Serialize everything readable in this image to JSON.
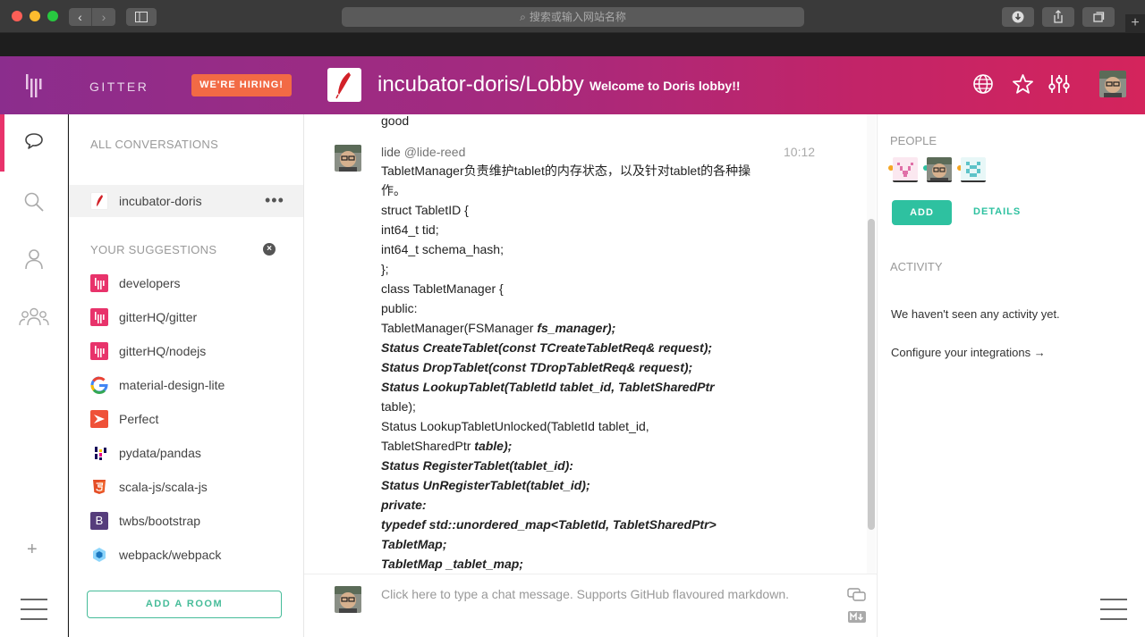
{
  "browser": {
    "url_placeholder": "搜索或输入网站名称",
    "new_tab": "+"
  },
  "header": {
    "brand": "GITTER",
    "hiring": "WE'RE HIRING!",
    "room_title": "incubator-doris/Lobby",
    "room_topic": "Welcome to Doris lobby!!",
    "icons": [
      "globe-icon",
      "star-icon",
      "settings-sliders-icon"
    ]
  },
  "rail": {
    "add": "+"
  },
  "conversations": {
    "all_label": "ALL CONVERSATIONS",
    "active": {
      "label": "incubator-doris",
      "more": "•••"
    },
    "suggestions_label": "YOUR SUGGESTIONS",
    "dismiss": "×",
    "suggestions": [
      {
        "label": "developers",
        "icon": "gitter-icon",
        "color": "#e8336b"
      },
      {
        "label": "gitterHQ/gitter",
        "icon": "gitter-icon",
        "color": "#e8336b"
      },
      {
        "label": "gitterHQ/nodejs",
        "icon": "gitter-icon",
        "color": "#e8336b"
      },
      {
        "label": "material-design-lite",
        "icon": "google-icon",
        "color": "#4285f4"
      },
      {
        "label": "Perfect",
        "icon": "perfect-icon",
        "color": "#ef5138"
      },
      {
        "label": "pydata/pandas",
        "icon": "pandas-icon",
        "color": "#e70488"
      },
      {
        "label": "scala-js/scala-js",
        "icon": "html5-icon",
        "color": "#e44d26"
      },
      {
        "label": "twbs/bootstrap",
        "icon": "bootstrap-icon",
        "color": "#563d7c"
      },
      {
        "label": "webpack/webpack",
        "icon": "webpack-icon",
        "color": "#1c78c0"
      }
    ],
    "add_room": "ADD A ROOM"
  },
  "chat": {
    "prev_message_tail": "good",
    "message": {
      "author": "lide",
      "username": "@lide-reed",
      "time": "10:12",
      "lines": [
        {
          "t": "TabletManager负责维护tablet的内存状态，以及针对tablet的各种操",
          "bold": ""
        },
        {
          "t": "作。",
          "bold": ""
        },
        {
          "t": "struct TabletID {",
          "bold": ""
        },
        {
          "t": "int64_t tid;",
          "bold": ""
        },
        {
          "t": "int64_t schema_hash;",
          "bold": ""
        },
        {
          "t": "};",
          "bold": ""
        },
        {
          "t": "class TabletManager {",
          "bold": ""
        },
        {
          "t": "public:",
          "bold": ""
        },
        {
          "t": "TabletManager(FSManager ",
          "bold": "fs_manager);"
        },
        {
          "t": "",
          "bold": "Status CreateTablet(const TCreateTabletReq& request);"
        },
        {
          "t": "",
          "bold": "Status DropTablet(const TDropTabletReq& request);"
        },
        {
          "t": "",
          "bold": "Status LookupTablet(TabletId tablet_id, TabletSharedPtr"
        },
        {
          "t": "table);",
          "bold": ""
        },
        {
          "t": "Status LookupTabletUnlocked(TabletId tablet_id,",
          "bold": ""
        },
        {
          "t": "TabletSharedPtr ",
          "bold": "table);"
        },
        {
          "t": "",
          "bold": "Status RegisterTablet(tablet_id):"
        },
        {
          "t": "",
          "bold": "Status UnRegisterTablet(tablet_id);"
        },
        {
          "t": "",
          "bold": "private:"
        },
        {
          "t": "",
          "bold": "typedef std::unordered_map<TabletId, TabletSharedPtr>"
        },
        {
          "t": "",
          "bold": "TabletMap;"
        },
        {
          "t": "",
          "bold": "TabletMap _tablet_map;"
        }
      ]
    },
    "composer_placeholder": "Click here to type a chat message. Supports GitHub flavoured markdown."
  },
  "right_panel": {
    "people_label": "PEOPLE",
    "add": "ADD",
    "details": "DETAILS",
    "activity_label": "ACTIVITY",
    "activity_empty": "We haven't seen any activity yet.",
    "integrations_link": "Configure your integrations →"
  }
}
